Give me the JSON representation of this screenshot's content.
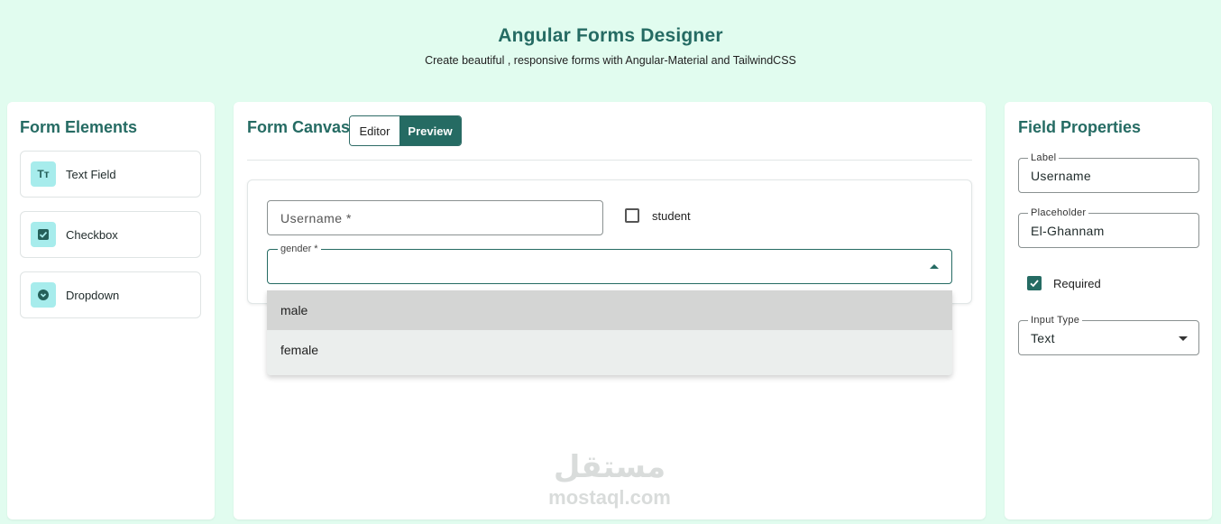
{
  "header": {
    "title": "Angular Forms Designer",
    "subtitle": "Create beautiful , responsive forms with Angular-Material and TailwindCSS"
  },
  "elements_panel": {
    "title": "Form Elements",
    "items": [
      {
        "label": "Text Field",
        "icon": "text-format-icon",
        "glyph": "Tт"
      },
      {
        "label": "Checkbox",
        "icon": "checkbox-icon",
        "glyph": "✓"
      },
      {
        "label": "Dropdown",
        "icon": "dropdown-icon",
        "glyph": "⌄"
      }
    ]
  },
  "canvas": {
    "title": "Form Canvas",
    "tabs": {
      "editor": "Editor",
      "preview": "Preview",
      "active": "Preview"
    },
    "form": {
      "username_placeholder": "Username *",
      "student_label": "student",
      "gender_label": "gender *",
      "gender_options": [
        "male",
        "female"
      ],
      "highlighted_option": "male"
    }
  },
  "properties": {
    "title": "Field Properties",
    "label_label": "Label",
    "label_value": "Username",
    "placeholder_label": "Placeholder",
    "placeholder_value": "El-Ghannam",
    "required_label": "Required",
    "required_checked": true,
    "input_type_label": "Input Type",
    "input_type_value": "Text"
  },
  "watermark": {
    "arabic": "مستقل",
    "latin": "mostaql.com"
  },
  "colors": {
    "background": "#e1fcef",
    "accent": "#256b63",
    "icon_bg": "#a7ecec"
  }
}
